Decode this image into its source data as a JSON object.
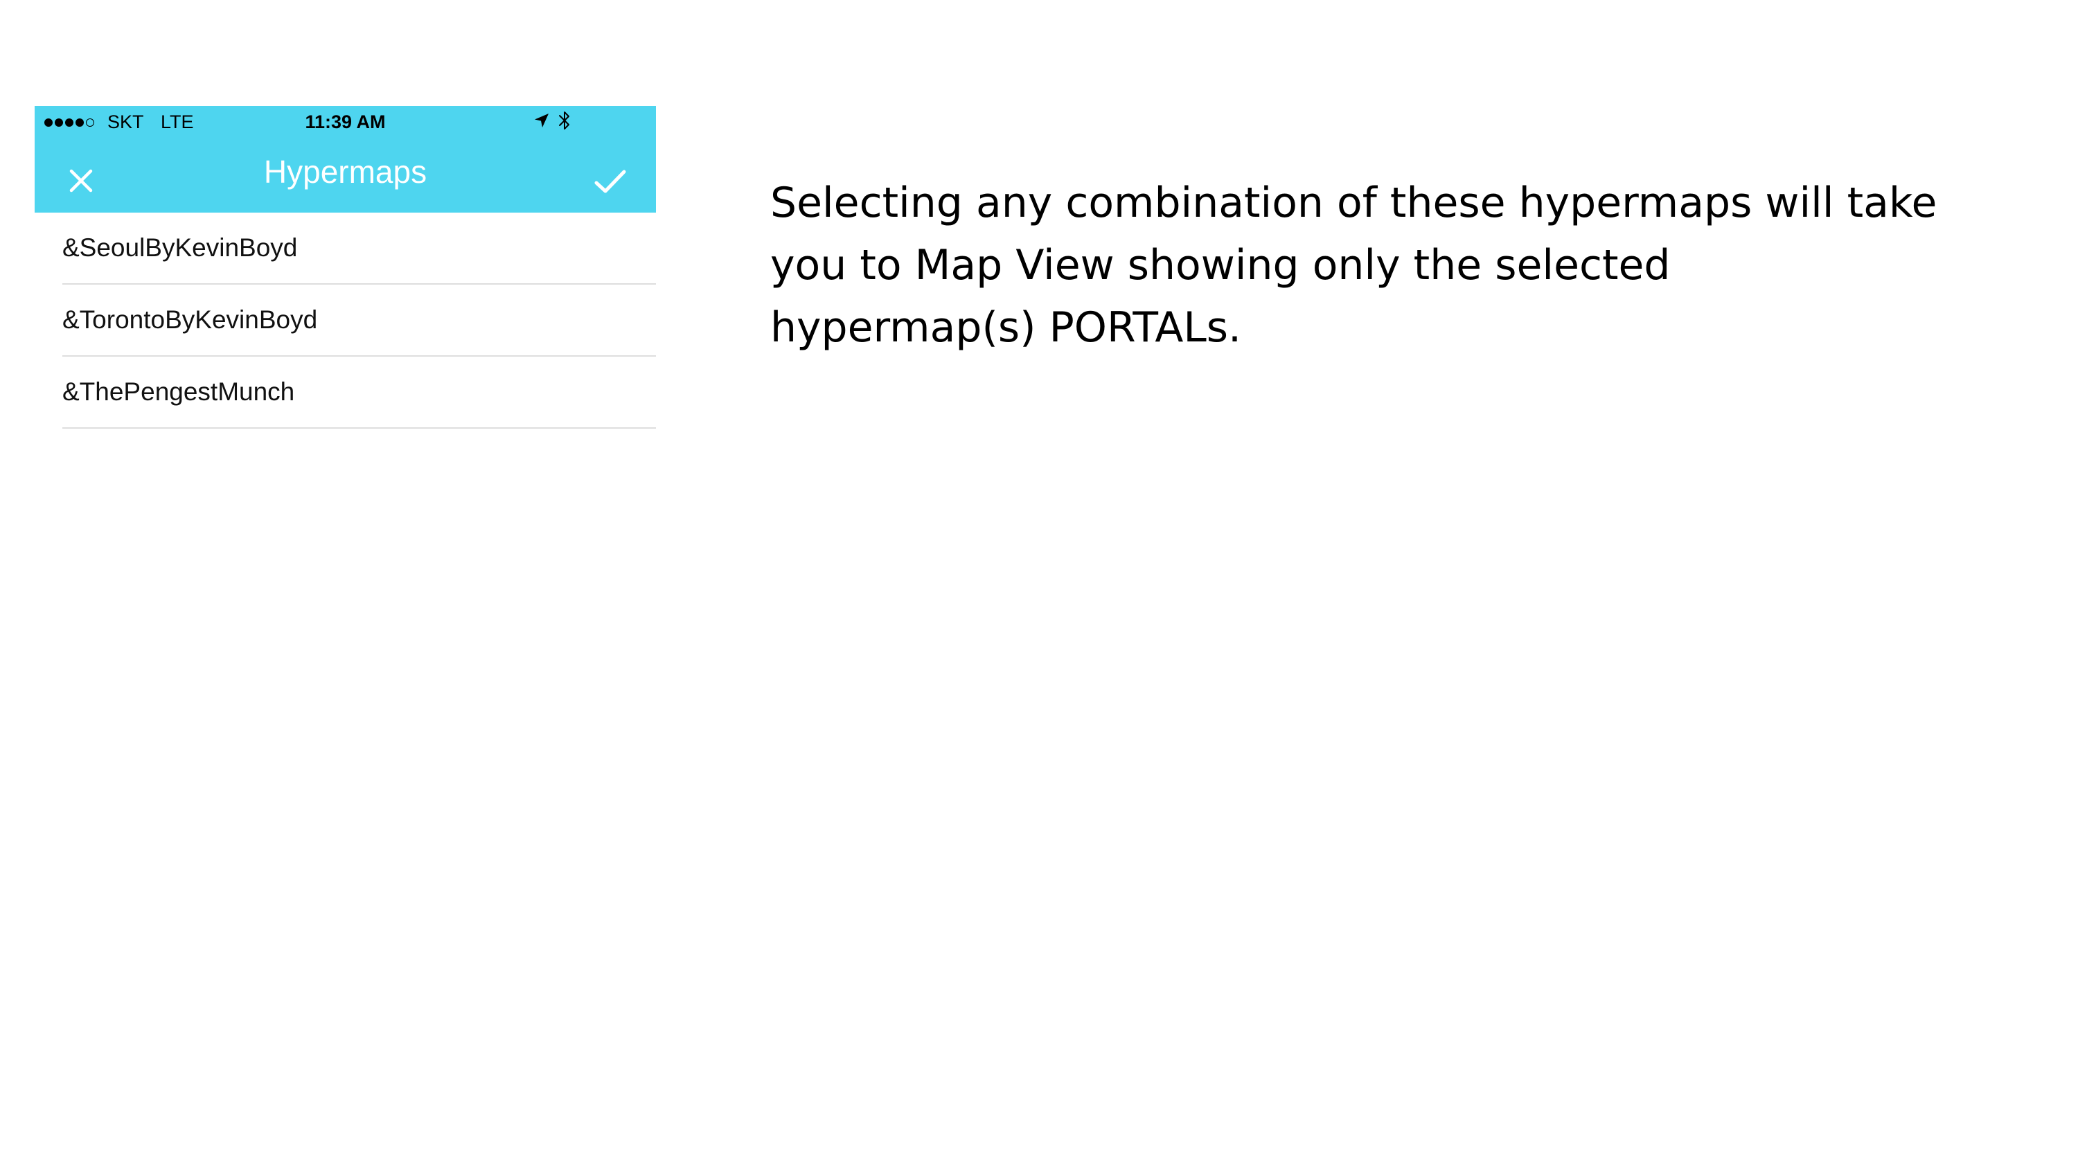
{
  "status_bar": {
    "carrier": "SKT",
    "network": "LTE",
    "time": "11:39 AM",
    "signal_bars_filled": 4,
    "signal_bars_total": 5,
    "icons": [
      "location-arrow-icon",
      "bluetooth-icon"
    ]
  },
  "nav": {
    "title": "Hypermaps",
    "close_icon": "close-icon",
    "confirm_icon": "checkmark-icon",
    "background_color": "#4ed5ef"
  },
  "hypermaps": [
    {
      "label": "&SeoulByKevinBoyd"
    },
    {
      "label": "&TorontoByKevinBoyd"
    },
    {
      "label": "&ThePengestMunch"
    }
  ],
  "description": "Selecting any combination of these hypermaps will take you to Map View showing only the selected hypermap(s) PORTALs."
}
